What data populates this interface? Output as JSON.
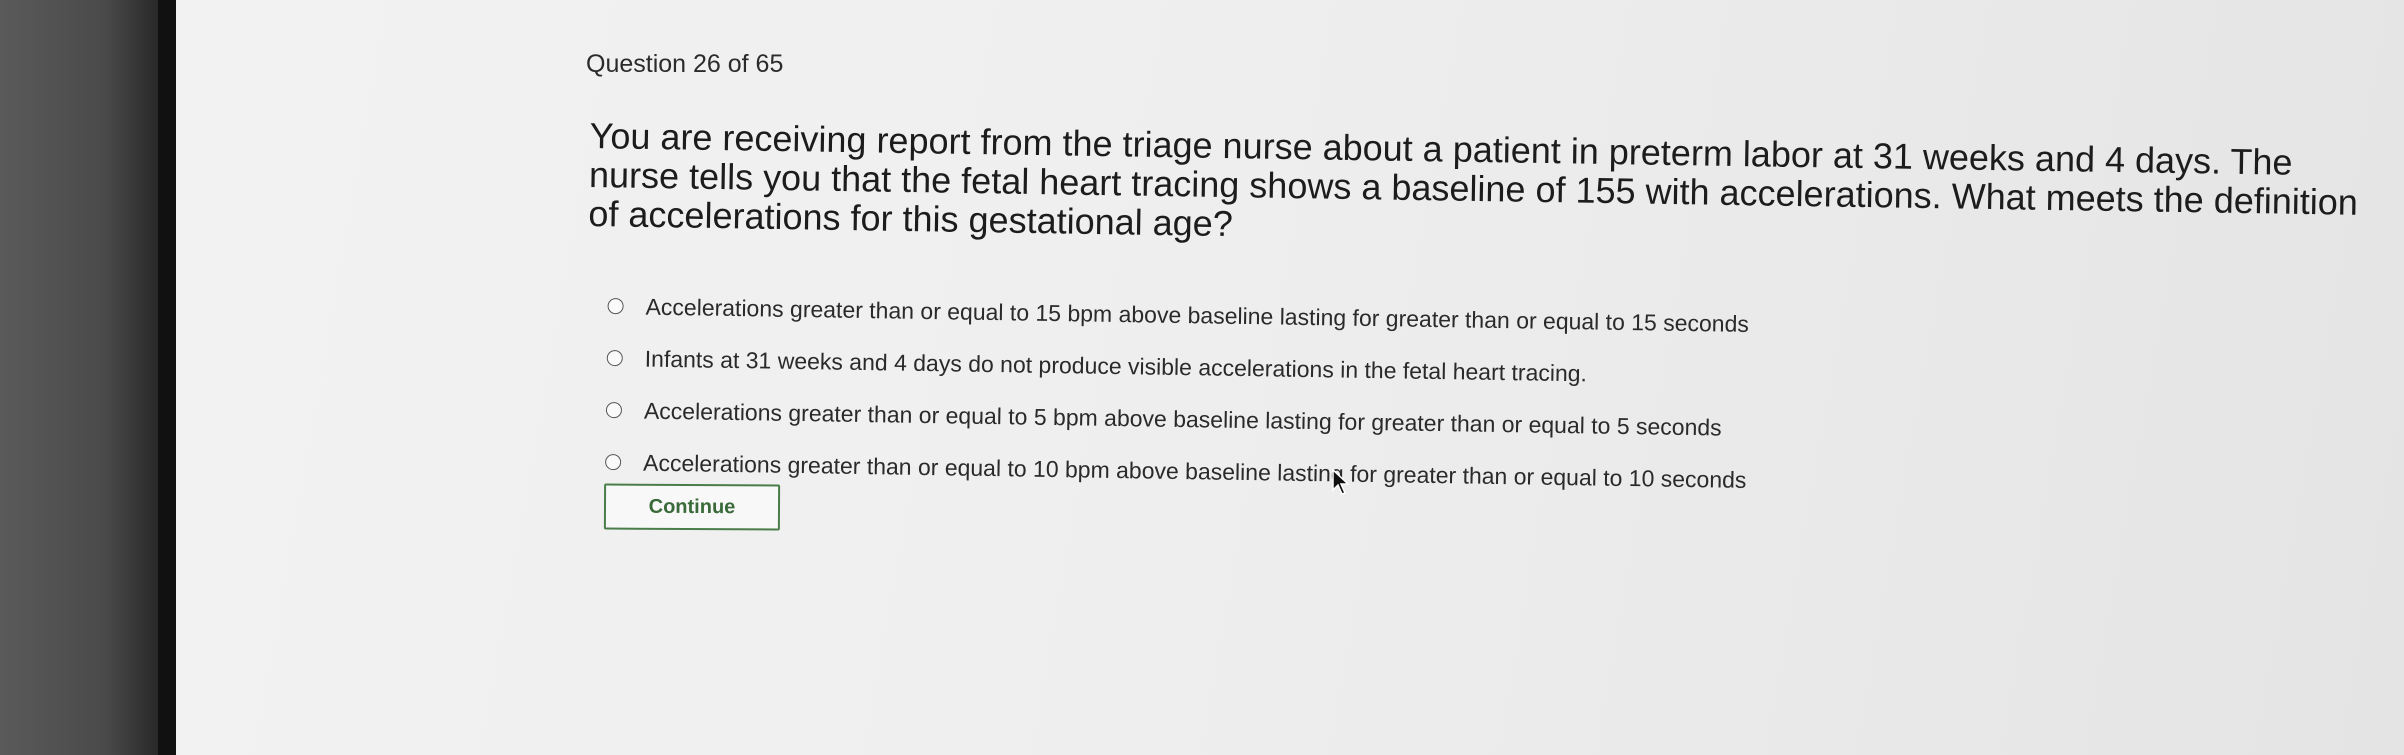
{
  "quiz": {
    "counter": "Question 26 of 65",
    "question": "You are receiving report from the triage nurse about a patient in preterm labor at 31 weeks and 4 days. The nurse tells you that the fetal heart tracing shows a baseline of 155 with accelerations. What meets the definition of accelerations for this gestational age?",
    "options": [
      {
        "label": "Accelerations greater than or equal to 15 bpm above baseline lasting for greater than or equal to 15 seconds"
      },
      {
        "label": "Infants at 31 weeks and 4 days do not produce visible accelerations in the fetal heart tracing."
      },
      {
        "label": "Accelerations greater than or equal to 5 bpm above baseline lasting for greater than or equal to 5 seconds"
      },
      {
        "label": "Accelerations greater than or equal to 10 bpm above baseline lasting for greater than or equal to 10 seconds"
      }
    ],
    "continue_label": "Continue"
  },
  "colors": {
    "button_border": "#4a7d4a",
    "button_text": "#3a6a3a"
  },
  "icons": {
    "cursor": "mouse-pointer-icon"
  }
}
